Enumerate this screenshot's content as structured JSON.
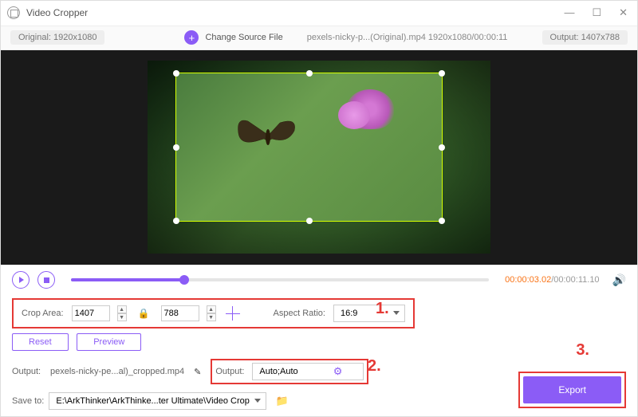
{
  "titlebar": {
    "title": "Video Cropper"
  },
  "infobar": {
    "original": "Original: 1920x1080",
    "change_src": "Change Source File",
    "file_info": "pexels-nicky-p...(Original).mp4    1920x1080/00:00:11",
    "output": "Output: 1407x788"
  },
  "playback": {
    "current_time": "00:00:03.02",
    "total_time": "/00:00:11.10"
  },
  "crop": {
    "area_label": "Crop Area:",
    "width": "1407",
    "height": "788",
    "ratio_label": "Aspect Ratio:",
    "ratio_value": "16:9"
  },
  "annotations": {
    "n1": "1.",
    "n2": "2.",
    "n3": "3."
  },
  "buttons": {
    "reset": "Reset",
    "preview": "Preview",
    "export": "Export"
  },
  "output_row": {
    "label": "Output:",
    "filename": "pexels-nicky-pe...al)_cropped.mp4",
    "fmt_label": "Output:",
    "fmt_value": "Auto;Auto"
  },
  "save_row": {
    "label": "Save to:",
    "path": "E:\\ArkThinker\\ArkThinke...ter Ultimate\\Video Crop"
  }
}
